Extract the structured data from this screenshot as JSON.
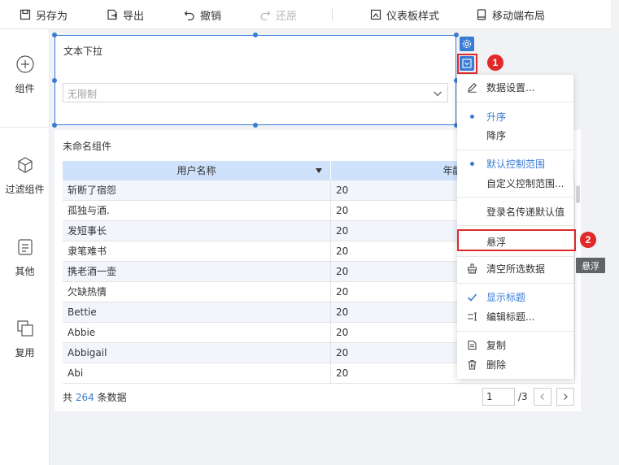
{
  "toolbar": {
    "save_as": "另存为",
    "export": "导出",
    "undo": "撤销",
    "redo": "还原",
    "dashboard_style": "仪表板样式",
    "mobile_layout": "移动端布局"
  },
  "sidebar": {
    "components": "组件",
    "filter_components": "过滤组件",
    "other": "其他",
    "reuse": "复用"
  },
  "filter_widget": {
    "title": "文本下拉",
    "select_value": "无限制"
  },
  "table_widget": {
    "title": "未命名组件",
    "columns": [
      "用户名称",
      "年龄"
    ],
    "rows": [
      [
        "斩断了宿怨",
        "20"
      ],
      [
        "孤独与酒.",
        "20"
      ],
      [
        "发短事长",
        "20"
      ],
      [
        "隶笔难书",
        "20"
      ],
      [
        "携老酒一壶",
        "20"
      ],
      [
        "欠缺热情",
        "20"
      ],
      [
        "Bettie",
        "20"
      ],
      [
        "Abbie",
        "20"
      ],
      [
        "Abbigail",
        "20"
      ],
      [
        "Abi",
        "20"
      ]
    ],
    "footer_prefix": "共",
    "total": "264",
    "footer_suffix": "条数据",
    "page_current": "1",
    "page_total": "/3"
  },
  "menu": {
    "data_settings": "数据设置...",
    "ascending": "升序",
    "descending": "降序",
    "default_scope": "默认控制范围",
    "custom_scope": "自定义控制范围...",
    "login_default": "登录名传递默认值",
    "float": "悬浮",
    "clear_selected": "清空所选数据",
    "show_title": "显示标题",
    "edit_title": "编辑标题...",
    "copy": "复制",
    "delete": "删除"
  },
  "tooltip": "悬浮",
  "markers": [
    "1",
    "2"
  ],
  "colors": {
    "accent": "#3a7bd5",
    "highlight": "#e02a2a",
    "header_bg": "#cfe2fb"
  }
}
